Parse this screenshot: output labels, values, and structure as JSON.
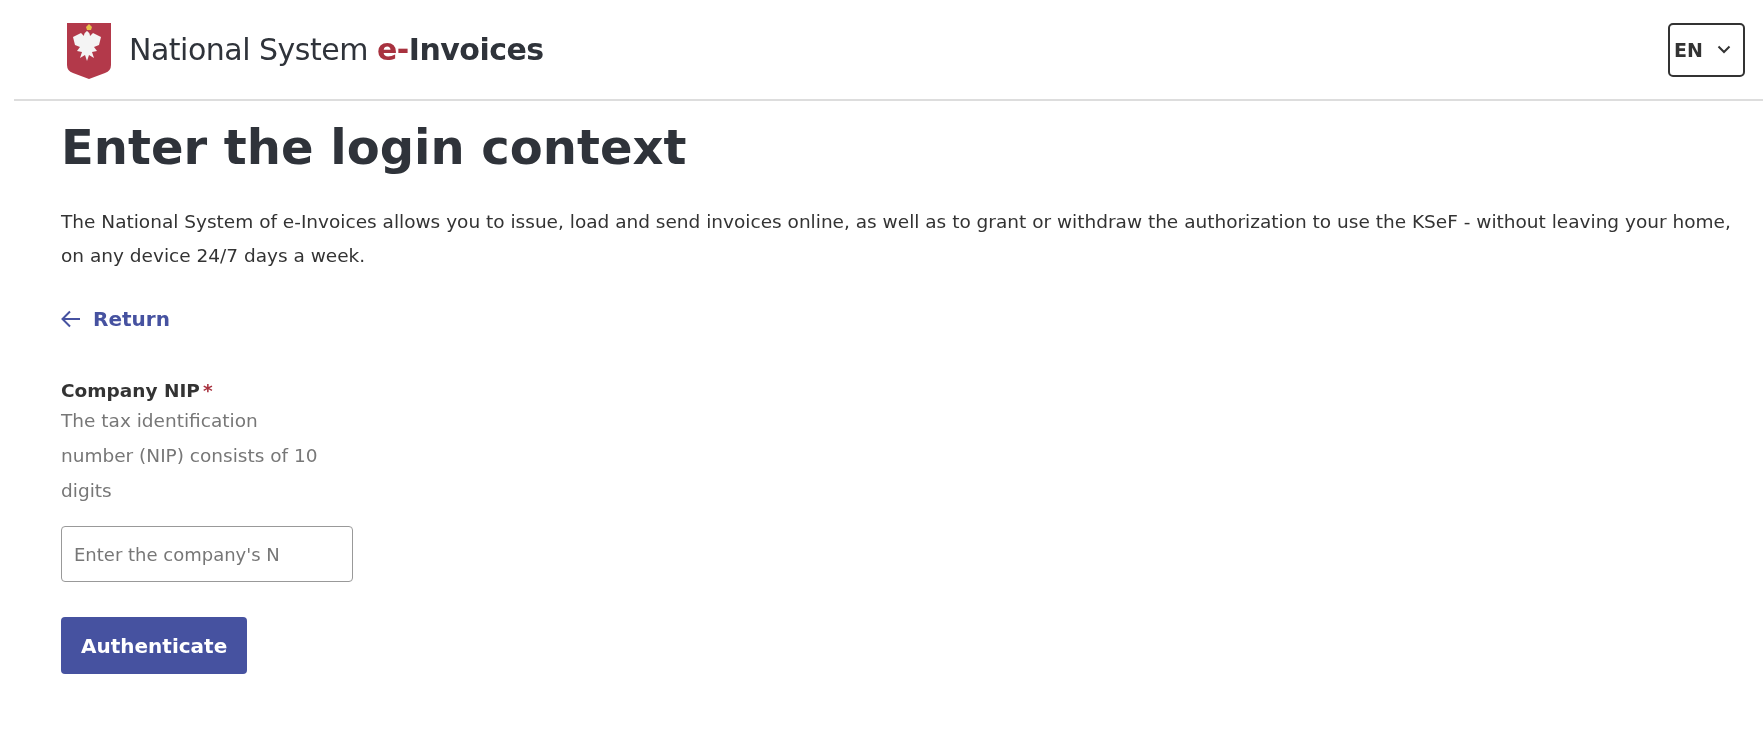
{
  "header": {
    "brand_regular": "National System",
    "brand_accent": "e-",
    "brand_bold": "Invoices",
    "language": "EN"
  },
  "title": "Enter the login context",
  "description": "The National System of e-Invoices allows you to issue, load and send invoices online, as well as to grant or withdraw the authorization to use the KSeF - without leaving your home, on any device 24/7 days a week.",
  "return_link": "Return",
  "field": {
    "label": "Company NIP",
    "required_mark": "*",
    "hint": "The tax identification number (NIP) consists of 10 digits",
    "placeholder": "Enter the company's N"
  },
  "buttons": [
    "Authenticate"
  ]
}
